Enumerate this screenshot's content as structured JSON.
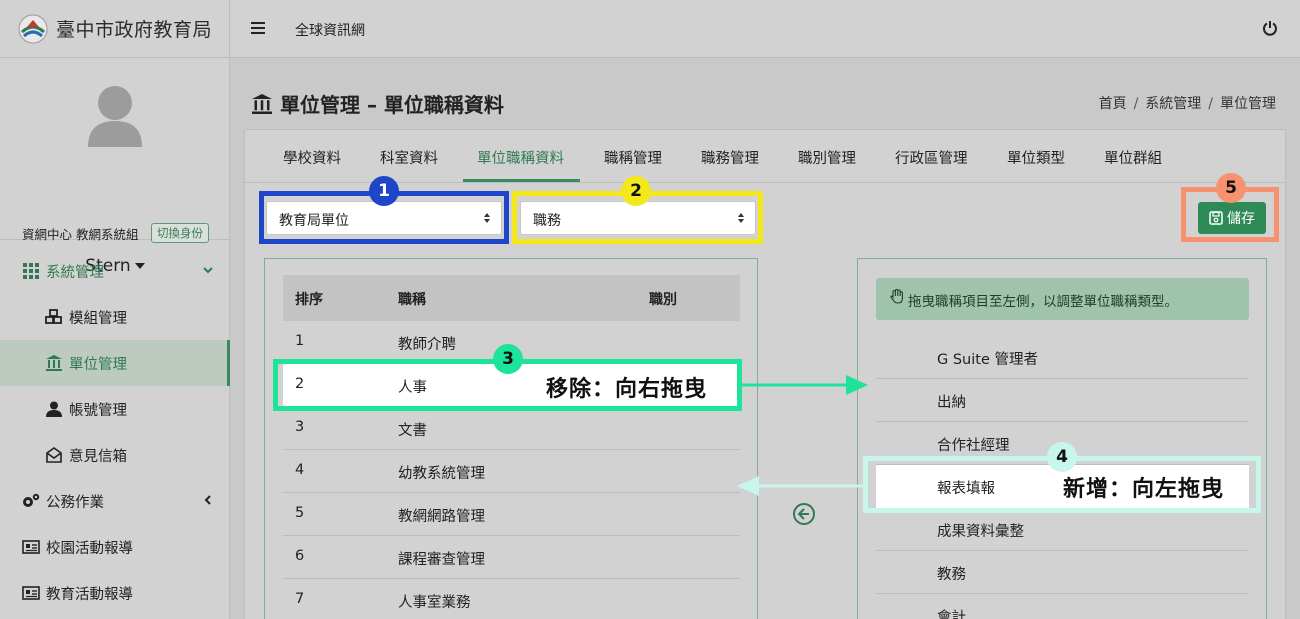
{
  "brand": {
    "title": "臺中市政府教育局",
    "logo": "city-logo"
  },
  "user": {
    "org": "資網中心 教網系統組",
    "switch_label": "切換身份",
    "name": "Stern"
  },
  "sidebar": {
    "items": [
      {
        "label": "系統管理",
        "icon": "grid-icon"
      },
      {
        "label": "模組管理",
        "icon": "cubes-icon"
      },
      {
        "label": "單位管理",
        "icon": "building-icon"
      },
      {
        "label": "帳號管理",
        "icon": "user-icon"
      },
      {
        "label": "意見信箱",
        "icon": "envelope-open-icon"
      },
      {
        "label": "公務作業",
        "icon": "gears-icon"
      },
      {
        "label": "校園活動報導",
        "icon": "newspaper-icon"
      },
      {
        "label": "教育活動報導",
        "icon": "newspaper-icon"
      }
    ]
  },
  "topbar": {
    "link": "全球資訊網"
  },
  "page": {
    "title": "單位管理 – 單位職稱資料"
  },
  "breadcrumb": {
    "home": "首頁",
    "level1": "系統管理",
    "level2": "單位管理",
    "sep": "/"
  },
  "tabs": [
    "學校資料",
    "科室資料",
    "單位職稱資料",
    "職稱管理",
    "職務管理",
    "職別管理",
    "行政區管理",
    "單位類型",
    "單位群組"
  ],
  "filters": {
    "unit_select": "教育局單位",
    "type_select": "職務"
  },
  "save_label": "儲存",
  "table": {
    "headers": [
      "排序",
      "職稱",
      "職別"
    ],
    "rows": [
      {
        "order": "1",
        "title": "教師介聘"
      },
      {
        "order": "2",
        "title": "人事"
      },
      {
        "order": "3",
        "title": "文書"
      },
      {
        "order": "4",
        "title": "幼教系統管理"
      },
      {
        "order": "5",
        "title": "教網網路管理"
      },
      {
        "order": "6",
        "title": "課程審查管理"
      },
      {
        "order": "7",
        "title": "人事室業務"
      }
    ]
  },
  "right_panel": {
    "hint": "拖曳職稱項目至左側，以調整單位職稱類型。",
    "items": [
      "G Suite 管理者",
      "出納",
      "合作社經理",
      "報表填報",
      "成果資料彙整",
      "教務",
      "會計"
    ]
  },
  "annotations": {
    "badges": [
      "1",
      "2",
      "3",
      "4",
      "5"
    ],
    "remove_text": "移除：向右拖曳",
    "add_text": "新增：向左拖曳",
    "colors": {
      "blue": "#1f46c8",
      "yellow": "#f2e81a",
      "green": "#1ee39a",
      "cyan": "#c9f6ec",
      "orange": "#f6936e",
      "brand_green": "#2e8b58"
    }
  }
}
